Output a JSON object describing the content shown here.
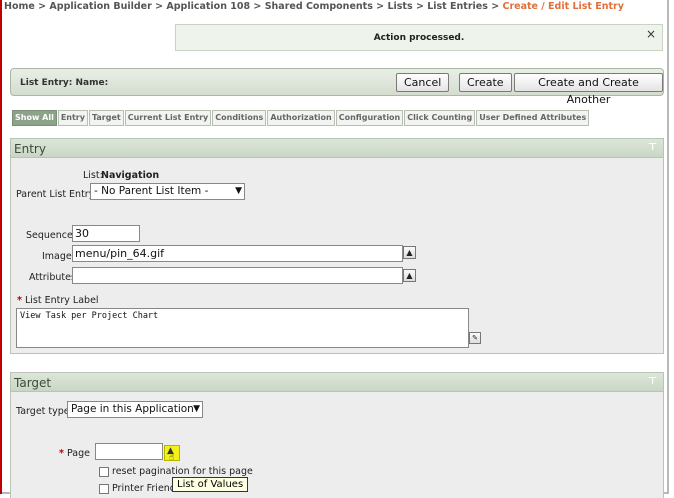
{
  "breadcrumb": {
    "items": [
      "Home",
      "Application Builder",
      "Application 108",
      "Shared Components",
      "Lists",
      "List Entries"
    ],
    "current": "Create / Edit List Entry",
    "separator": ">"
  },
  "message": {
    "text": "Action processed.",
    "close": "×"
  },
  "button_bar": {
    "label": "List Entry:  Name:",
    "cancel": "Cancel",
    "create": "Create",
    "create_another": "Create and Create Another"
  },
  "tabs": [
    "Show All",
    "Entry",
    "Target",
    "Current List Entry",
    "Conditions",
    "Authorization",
    "Configuration",
    "Click Counting",
    "User Defined Attributes"
  ],
  "entry": {
    "title": "Entry",
    "list_label": "List:",
    "list_value": "Navigation",
    "parent_label": "Parent List Entry",
    "parent_value": "- No Parent List Item -",
    "sequence_label": "Sequence",
    "sequence_value": "30",
    "image_label": "Image",
    "image_value": "menu/pin_64.gif",
    "attributes_label": "Attributes",
    "attributes_value": "",
    "entry_label_label": "List Entry Label",
    "entry_label_value": "View Task per Project Chart"
  },
  "target": {
    "title": "Target",
    "type_label": "Target type",
    "type_value": "Page in this Application",
    "page_label": "Page",
    "page_value": "",
    "reset_pagination": "reset pagination for this page",
    "printer_friendly": "Printer Friendl",
    "tooltip": "List of Values"
  },
  "colors": {
    "accent": "#e0703a",
    "required": "#c00000",
    "region_header": "#c9d6c5"
  }
}
